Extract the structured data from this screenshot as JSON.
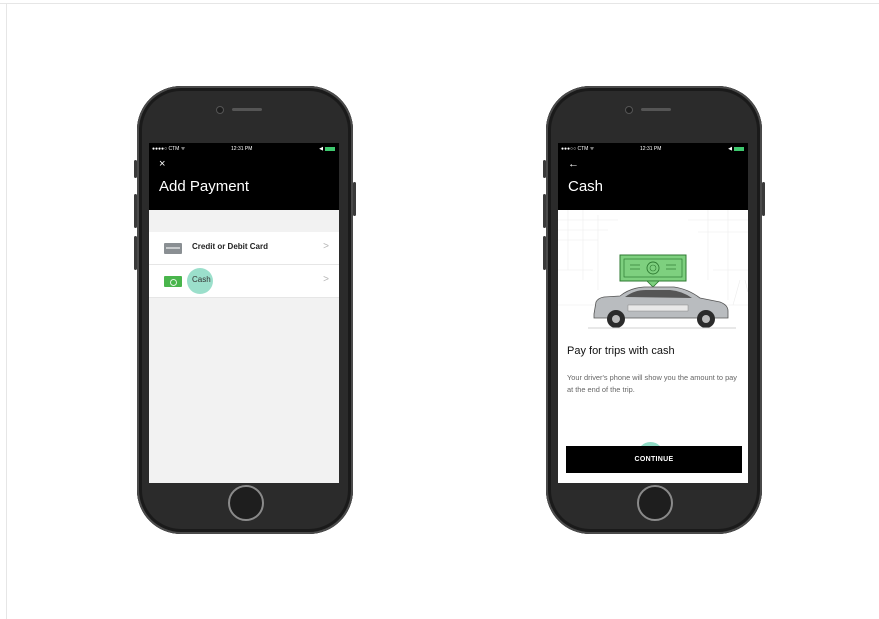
{
  "left_phone": {
    "status": {
      "carrier": "●●●●○ CTM ᯤ",
      "time": "12:31 PM",
      "battery": "◀"
    },
    "nav_icon": "×",
    "title": "Add Payment",
    "items": [
      {
        "label": "Credit or Debit Card",
        "icon": "credit-card-icon",
        "chevron": ">"
      },
      {
        "label": "Cash",
        "icon": "cash-icon",
        "chevron": ">"
      }
    ]
  },
  "right_phone": {
    "status": {
      "carrier": "●●●○○ CTM ᯤ",
      "time": "12:31 PM",
      "battery": "◀"
    },
    "nav_icon": "←",
    "title": "Cash",
    "heading": "Pay for trips with cash",
    "description": "Your driver's phone will show you the amount to pay at the end of the trip.",
    "button_label": "CONTINUE"
  },
  "colors": {
    "accent_green": "#49b54c",
    "touch_teal": "#48c4a0",
    "header_black": "#000000"
  }
}
